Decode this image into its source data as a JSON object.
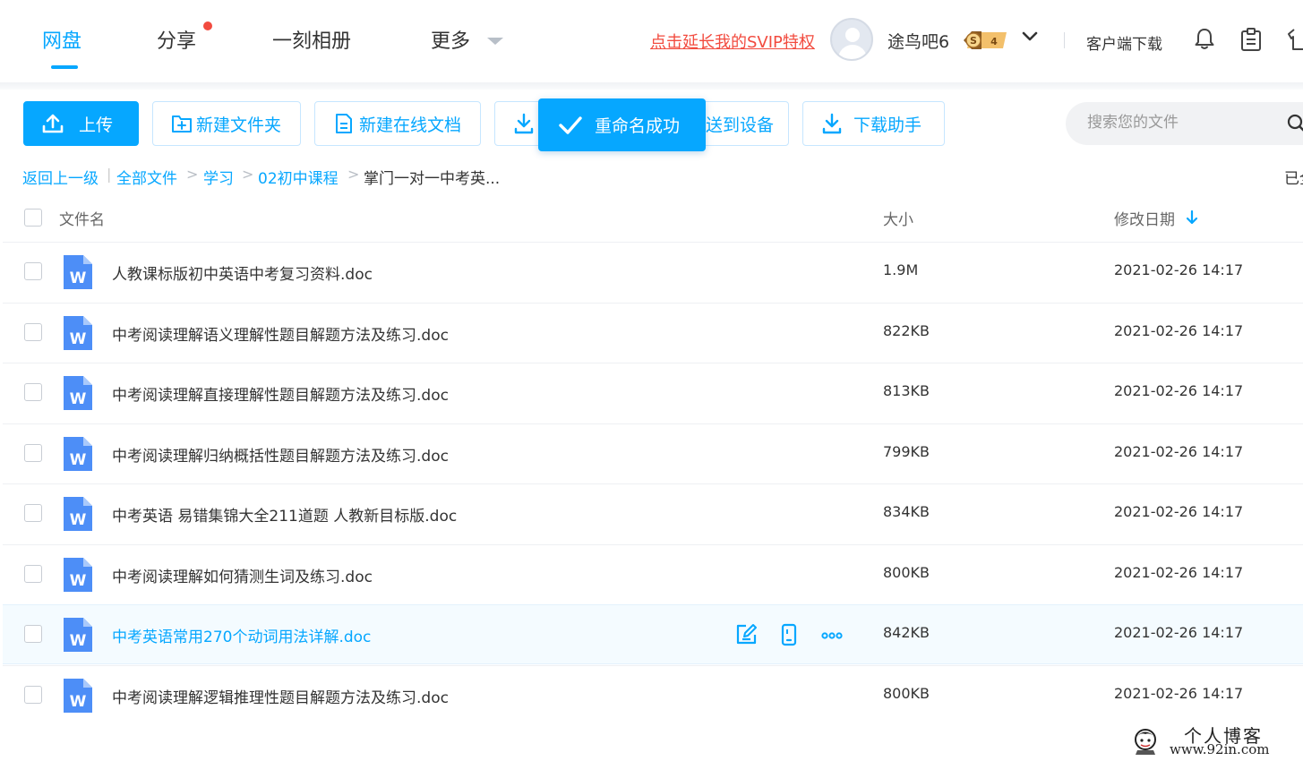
{
  "colors": {
    "accent": "#06a7ff",
    "warning": "#f24b3f",
    "text": "#333333",
    "muted": "#999999"
  },
  "nav": {
    "tabs": [
      {
        "label": "网盘",
        "active": true
      },
      {
        "label": "分享",
        "badge_dot": true
      },
      {
        "label": "一刻相册"
      },
      {
        "label": "更多"
      }
    ],
    "svip_link": "点击延长我的SVIP特权",
    "username": "途鸟吧6",
    "vip_level": "4",
    "vip_letter": "S",
    "client_download": "客户端下载",
    "icons": [
      "bell-icon",
      "clipboard-icon",
      "shirt-icon"
    ]
  },
  "toolbar": {
    "upload": "上传",
    "new_folder": "新建文件夹",
    "new_doc": "新建在线文档",
    "send_device": "送到设备",
    "download_helper": "下载助手",
    "toast": "重命名成功",
    "search_placeholder": "搜索您的文件"
  },
  "breadcrumb": {
    "back": "返回上一级",
    "all": "全部文件",
    "level1": "学习",
    "level2": "02初中课程",
    "current": "掌门一对一中考英...",
    "right_text": "已全"
  },
  "table": {
    "headers": {
      "name": "文件名",
      "size": "大小",
      "date": "修改日期"
    },
    "sort": "descending",
    "rows": [
      {
        "name": "人教课标版初中英语中考复习资料.doc",
        "size": "1.9M",
        "date": "2021-02-26 14:17"
      },
      {
        "name": "中考阅读理解语义理解性题目解题方法及练习.doc",
        "size": "822KB",
        "date": "2021-02-26 14:17"
      },
      {
        "name": "中考阅读理解直接理解性题目解题方法及练习.doc",
        "size": "813KB",
        "date": "2021-02-26 14:17"
      },
      {
        "name": "中考阅读理解归纳概括性题目解题方法及练习.doc",
        "size": "799KB",
        "date": "2021-02-26 14:17"
      },
      {
        "name": "中考英语 易错集锦大全211道题 人教新目标版.doc",
        "size": "834KB",
        "date": "2021-02-26 14:17"
      },
      {
        "name": "中考阅读理解如何猜测生词及练习.doc",
        "size": "800KB",
        "date": "2021-02-26 14:17"
      },
      {
        "name": "中考英语常用270个动词用法详解.doc",
        "size": "842KB",
        "date": "2021-02-26 14:17",
        "hovered": true
      },
      {
        "name": "中考阅读理解逻辑推理性题目解题方法及练习.doc",
        "size": "800KB",
        "date": "2021-02-26 14:17"
      }
    ]
  },
  "watermark": {
    "title": "个人博客",
    "url": "www.92in.com"
  }
}
